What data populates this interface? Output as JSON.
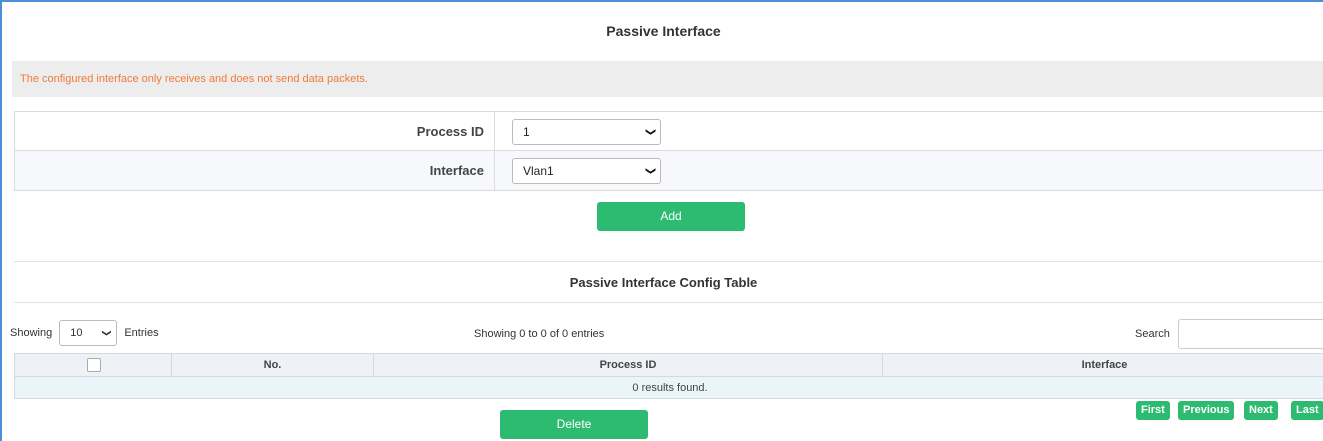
{
  "page": {
    "title": "Passive Interface",
    "notice": "The configured interface only receives and does not send data packets."
  },
  "form": {
    "process_id_label": "Process ID",
    "process_id_value": "1",
    "interface_label": "Interface",
    "interface_value": "Vlan1",
    "add_label": "Add"
  },
  "table": {
    "title": "Passive Interface Config Table",
    "showing_prefix": "Showing",
    "entries_value": "10",
    "entries_suffix": "Entries",
    "info": "Showing 0 to 0 of 0 entries",
    "search_label": "Search",
    "search_value": "",
    "columns": [
      "No.",
      "Process ID",
      "Interface"
    ],
    "empty_message": "0 results found.",
    "delete_label": "Delete"
  },
  "pagination": {
    "first": "First",
    "previous": "Previous",
    "next": "Next",
    "last": "Last"
  },
  "colors": {
    "accent_green": "#2dbb72",
    "notice_text": "#f07a3a",
    "frame_border": "#4a90d9"
  }
}
